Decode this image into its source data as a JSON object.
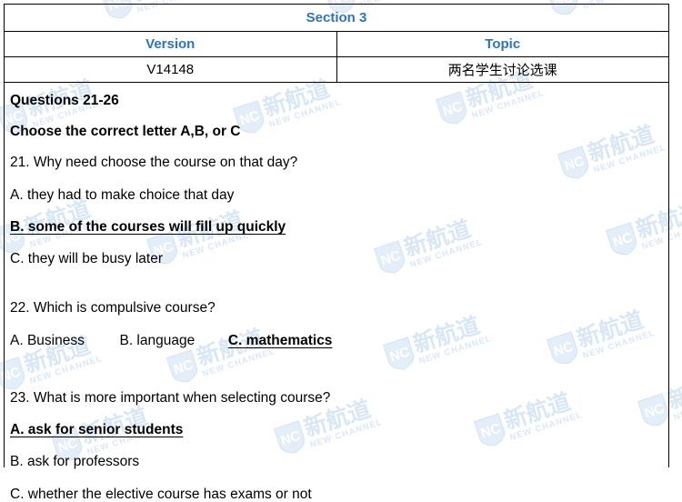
{
  "header": {
    "section_label": "Section 3",
    "columns": {
      "version_header": "Version",
      "topic_header": "Topic"
    },
    "row": {
      "version_value": "V14148",
      "topic_value": "两名学生讨论选课"
    }
  },
  "watermark": {
    "cn_text": "新航道",
    "en_text": "NEW CHANNEL",
    "logo_text": "NC",
    "color": "#d9e7f5"
  },
  "colors": {
    "heading_blue": "#2e74b5",
    "body_black": "#000000",
    "border_black": "#000000",
    "page_background": "#ffffff"
  },
  "content": {
    "questions_range_heading": "Questions 21-26",
    "instruction": "Choose the correct letter A,B, or C",
    "questions": [
      {
        "number": "21.",
        "prompt": "21. Why need choose the course on that day?",
        "layout": "stacked",
        "options": [
          {
            "text": "A. they had to make choice that day",
            "correct": false
          },
          {
            "text": "B. some of the courses will fill up quickly",
            "correct": true
          },
          {
            "text": "C. they will be busy later",
            "correct": false
          }
        ]
      },
      {
        "number": "22.",
        "prompt": "22. Which is compulsive course?",
        "layout": "inline",
        "options": [
          {
            "text": "A. Business",
            "correct": false
          },
          {
            "text": "B. language",
            "correct": false
          },
          {
            "text": "C. mathematics",
            "correct": true
          }
        ]
      },
      {
        "number": "23.",
        "prompt": "23. What is more important when selecting course?",
        "layout": "stacked",
        "options": [
          {
            "text": "A. ask for senior students",
            "correct": true
          },
          {
            "text": "B. ask for professors",
            "correct": false
          },
          {
            "text": "C. whether the elective course has exams or not",
            "correct": false
          }
        ]
      }
    ]
  }
}
